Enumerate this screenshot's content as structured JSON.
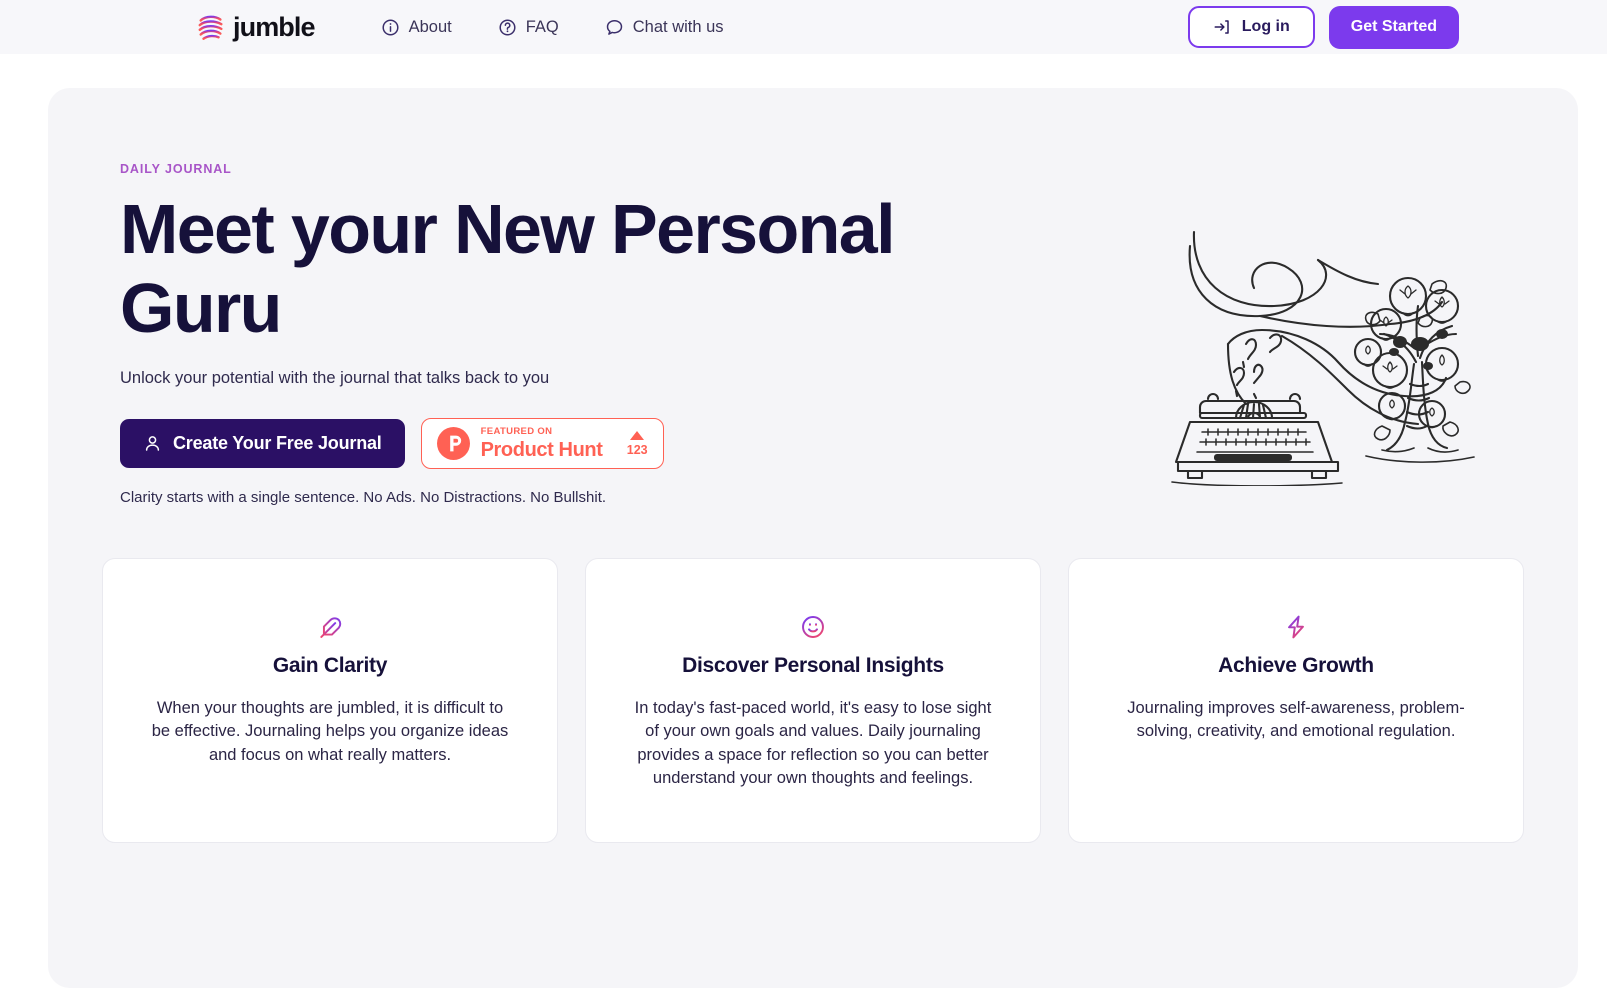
{
  "brand": {
    "name": "jumble",
    "logo_icon": "jumble-wave-logo",
    "gradient_from": "#7c3aed",
    "gradient_mid": "#e0457b",
    "gradient_to": "#ff6154"
  },
  "header": {
    "nav": [
      {
        "label": "About",
        "icon": "info-circle-icon"
      },
      {
        "label": "FAQ",
        "icon": "question-circle-icon"
      },
      {
        "label": "Chat with us",
        "icon": "chat-bubble-icon"
      }
    ],
    "login": {
      "label": "Log in",
      "icon": "login-arrow-icon"
    },
    "get_started": {
      "label": "Get Started"
    },
    "accent": "#7c3aed",
    "background": "#f7f7fa"
  },
  "hero": {
    "eyebrow": "DAILY JOURNAL",
    "eyebrow_color": "#a855c8",
    "title": "Meet your New Personal Guru",
    "subtitle": "Unlock your potential with the journal that talks back to you",
    "note": "Clarity starts with a single sentence. No Ads. No Distractions. No Bullshit.",
    "panel_background": "#f5f5f8",
    "title_color": "#16113a",
    "cta": {
      "label": "Create Your Free Journal",
      "icon": "user-icon",
      "background": "#2b1065"
    },
    "product_hunt": {
      "featured_label": "FEATURED ON",
      "name": "Product Hunt",
      "votes": "123",
      "logo_icon": "product-hunt-logo",
      "color": "#ff6154"
    },
    "illustration": {
      "icon": "typewriter-idea-tree-illustration",
      "description": "Hand-drawn typewriter with paper flowing into a tree of lightbulb leaves"
    }
  },
  "features": [
    {
      "icon": "feather-icon",
      "title": "Gain Clarity",
      "body": "When your thoughts are jumbled, it is difficult to be effective. Journaling helps you organize ideas and focus on what really matters."
    },
    {
      "icon": "smiley-face-icon",
      "title": "Discover Personal Insights",
      "body": "In today's fast-paced world, it's easy to lose sight of your own goals and values. Daily journaling provides a space for reflection so you can better understand your own thoughts and feelings."
    },
    {
      "icon": "lightning-bolt-icon",
      "title": "Achieve Growth",
      "body": "Journaling improves self-awareness, problem-solving, creativity, and emotional regulation."
    }
  ]
}
